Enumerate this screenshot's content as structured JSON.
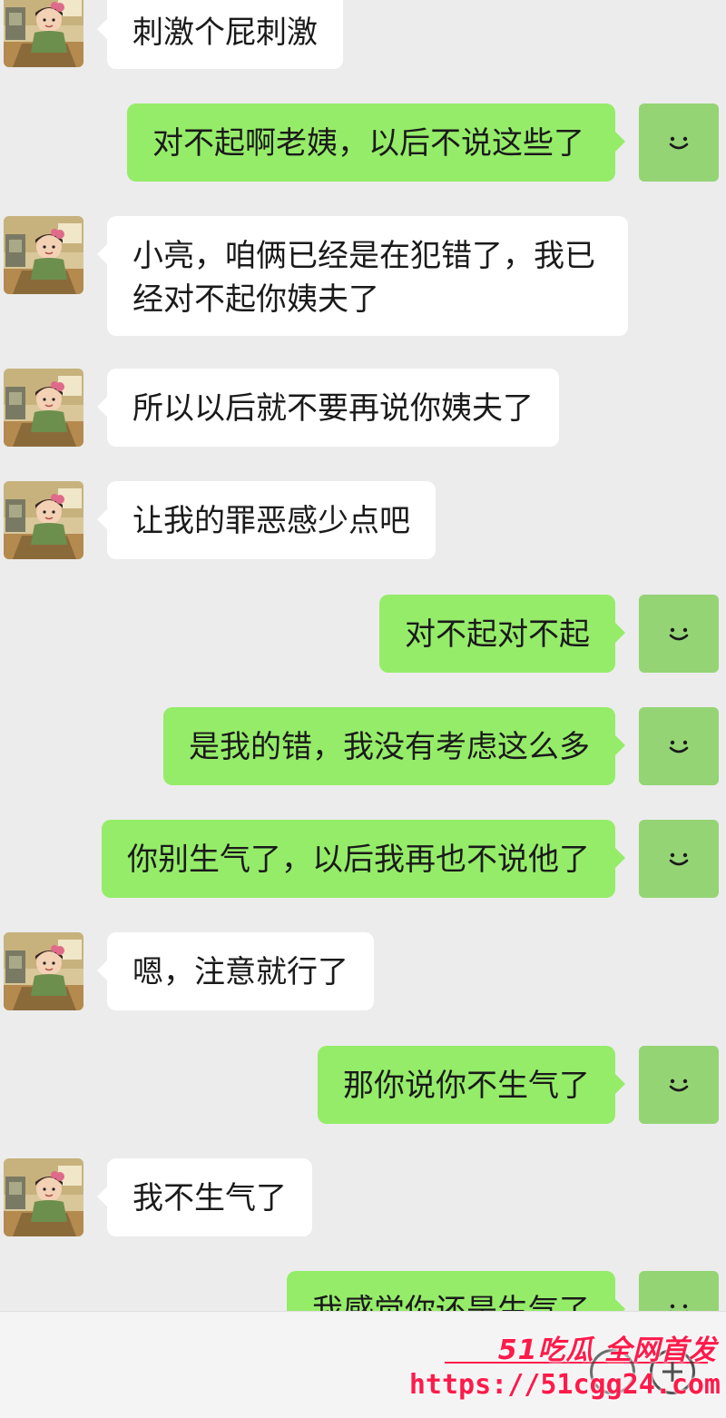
{
  "colors": {
    "background": "#ececec",
    "incoming_bubble": "#ffffff",
    "outgoing_bubble": "#95ec69",
    "self_avatar": "#95d475",
    "watermark": "#ff1a4a"
  },
  "messages": [
    {
      "side": "in",
      "text": "刺激个屁刺激"
    },
    {
      "side": "out",
      "text": "对不起啊老姨，以后不说这些了"
    },
    {
      "side": "in",
      "text": "小亮，咱俩已经是在犯错了，我已经对不起你姨夫了"
    },
    {
      "side": "in",
      "text": "所以以后就不要再说你姨夫了"
    },
    {
      "side": "in",
      "text": "让我的罪恶感少点吧"
    },
    {
      "side": "out",
      "text": "对不起对不起"
    },
    {
      "side": "out",
      "text": "是我的错，我没有考虑这么多"
    },
    {
      "side": "out",
      "text": "你别生气了，以后我再也不说他了"
    },
    {
      "side": "in",
      "text": "嗯，注意就行了"
    },
    {
      "side": "out",
      "text": "那你说你不生气了"
    },
    {
      "side": "in",
      "text": "我不生气了"
    },
    {
      "side": "out",
      "text": "我感觉你还是生气了"
    }
  ],
  "icons": {
    "contact_avatar": "cartoon-girl-avatar-icon",
    "self_avatar": "smiley-icon",
    "plus": "plus-icon",
    "emoji": "emoji-icon"
  },
  "watermark": {
    "brand": "51吃瓜 全网首发",
    "url": "https://51cgg24.com"
  }
}
